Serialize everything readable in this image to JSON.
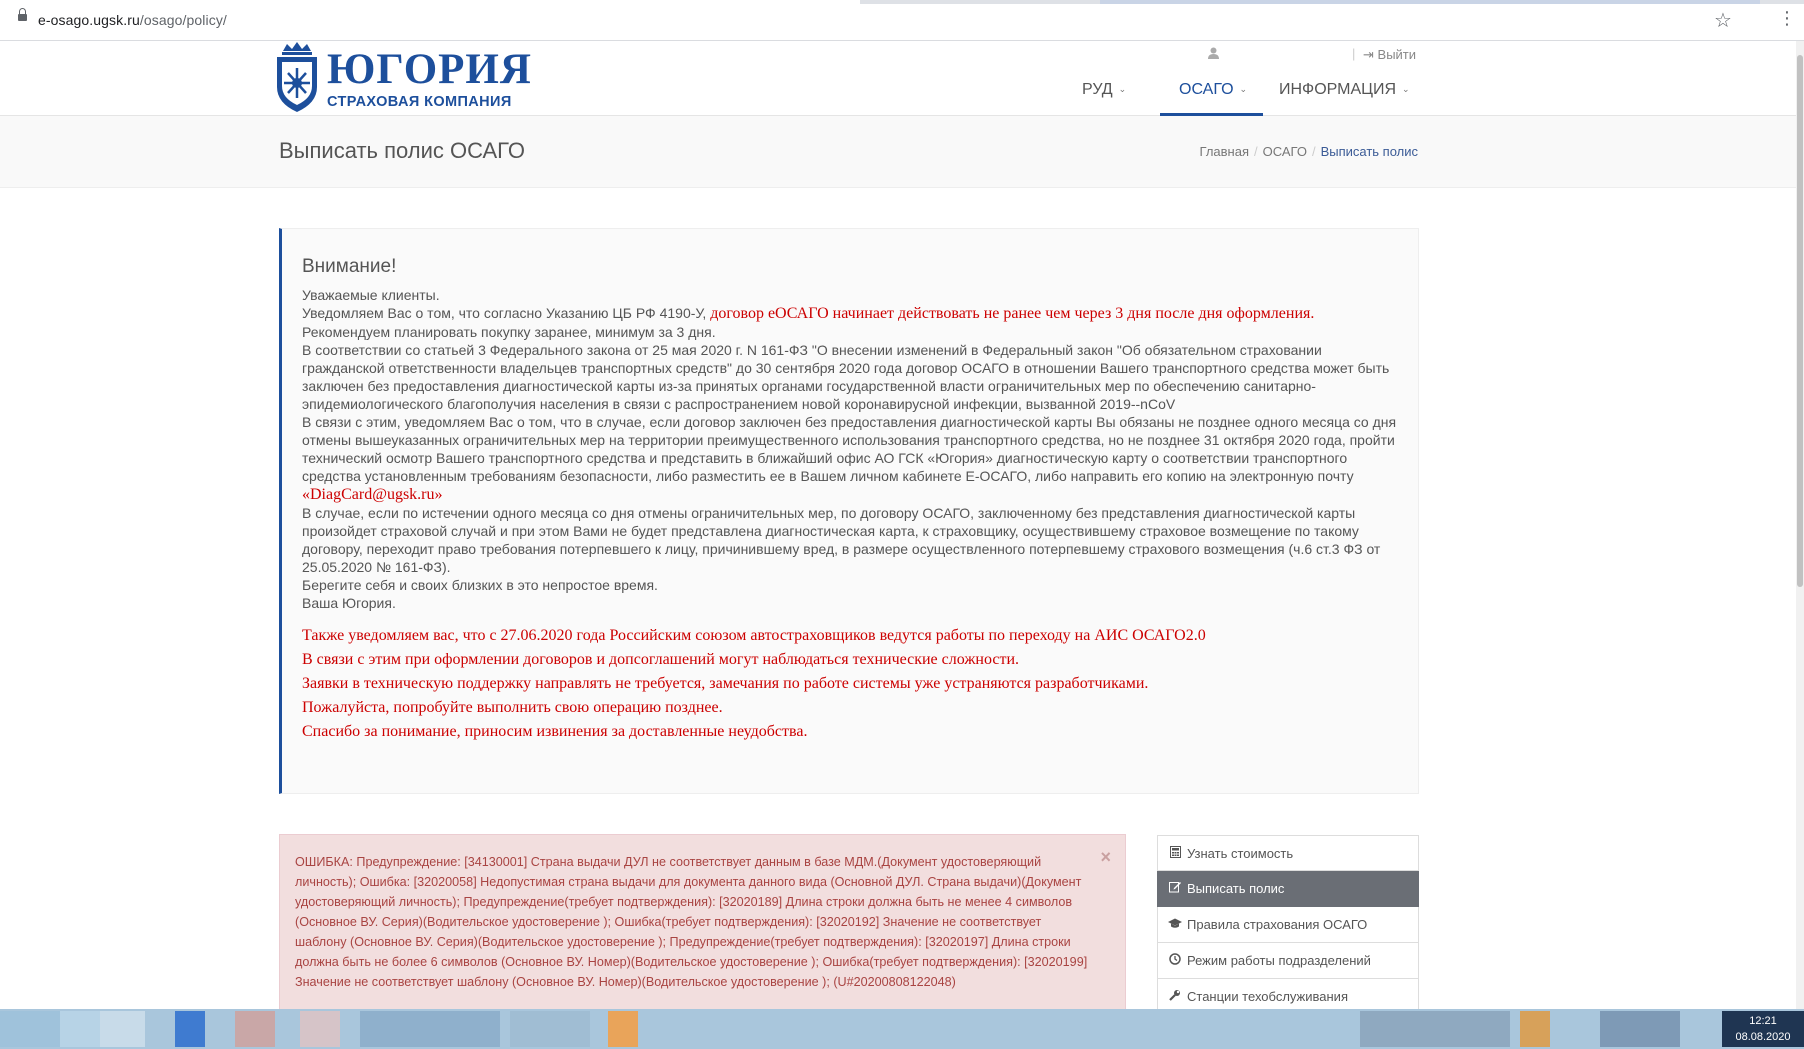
{
  "browser": {
    "url_host": "e-osago.ugsk.ru",
    "url_path": "/osago/policy/"
  },
  "header": {
    "brand": "ЮГОРИЯ",
    "brand_sub": "СТРАХОВАЯ КОМПАНИЯ",
    "logout_label": "Выйти",
    "nav": [
      {
        "label": "РУД"
      },
      {
        "label": "ОСАГО"
      },
      {
        "label": "ИНФОРМАЦИЯ"
      }
    ]
  },
  "page": {
    "title": "Выписать полис ОСАГО",
    "breadcrumbs": [
      "Главная",
      "ОСАГО",
      "Выписать полис"
    ]
  },
  "notice": {
    "heading": "Внимание!",
    "greeting": "Уважаемые клиенты.",
    "line1_prefix": "Уведомляем Вас о том, что согласно Указанию ЦБ РФ 4190-У, ",
    "line1_red": "договор еОСАГО начинает действовать не ранее чем через 3 дня после дня оформления.",
    "line2": "Рекомендуем планировать покупку заранее, минимум за 3 дня.",
    "para1": "В соответствии со статьей 3 Федерального закона от 25 мая 2020 г. N 161-ФЗ \"О внесении изменений в Федеральный закон \"Об обязательном страховании гражданской ответственности владельцев транспортных средств\" до 30 сентября 2020 года договор ОСАГО в отношении Вашего транспортного средства может быть заключен без предоставления диагностической карты из-за принятых органами государственной власти ограничительных мер по обеспечению санитарно-эпидемиологического благополучия населения в связи с распространением новой коронавирусной инфекции, вызванной 2019--nCoV",
    "para2": "В связи с этим, уведомляем Вас о том, что в случае, если договор заключен без предоставления диагностической карты Вы обязаны не позднее одного месяца со дня отмены вышеуказанных ограничительных мер на территории преимущественного использования транспортного средства, но не позднее 31 октября 2020 года, пройти технический осмотр Вашего транспортного средства и представить в ближайший офис АО ГСК «Югория» диагностическую карту о соответствии транспортного средства установленным требованиям безопасности, либо разместить ее в Вашем личном кабинете Е-ОСАГО, либо направить его копию на электронную почту ",
    "email": "«DiagCard@ugsk.ru»",
    "para3": "В случае, если по истечении одного месяца со дня отмены ограничительных мер, по договору ОСАГО, заключенному без представления диагностической карты произойдет страховой случай и при этом Вами не будет представлена диагностическая карта, к страховщику, осуществившему страховое возмещение по такому договору, переходит право требования потерпевшего к лицу, причинившему вред, в размере осуществленного потерпевшему страхового возмещения (ч.6 ст.3 ФЗ от 25.05.2020 № 161-ФЗ).",
    "para4": "Берегите себя и своих близких в это непростое время.",
    "signature": "Ваша Югория.",
    "red_lines": [
      "Также уведомляем вас, что с 27.06.2020 года Российским союзом автостраховщиков ведутся работы по переходу на АИС ОСАГО2.0",
      "В связи с этим при оформлении договоров и допсоглашений могут наблюдаться технические сложности.",
      "Заявки в техническую поддержку направлять не требуется, замечания по работе системы уже устраняются разработчиками.",
      "Пожалуйста, попробуйте выполнить свою операцию позднее.",
      "Спасибо за понимание, приносим извинения за доставленные неудобства."
    ]
  },
  "error": {
    "message": "ОШИБКА: Предупреждение: [34130001] Страна выдачи ДУЛ не соответствует данным в базе МДМ.(Документ удостоверяющий личность); Ошибка: [32020058] Недопустимая страна выдачи для документа данного вида (Основной ДУЛ. Страна выдачи)(Документ удостоверяющий личность); Предупреждение(требует подтверждения): [32020189] Длина строки должна быть не менее 4 символов (Основное ВУ. Серия)(Водительское удостоверение ); Ошибка(требует подтверждения): [32020192] Значение не соответствует шаблону (Основное ВУ. Серия)(Водительское удостоверение ); Предупреждение(требует подтверждения): [32020197] Длина строки должна быть не более 6 символов (Основное ВУ. Номер)(Водительское удостоверение ); Ошибка(требует подтверждения): [32020199] Значение не соответствует шаблону (Основное ВУ. Номер)(Водительское удостоверение ); (U#20200808122048)",
    "close_symbol": "×"
  },
  "sidemenu": [
    {
      "label": "Узнать стоимость",
      "icon": "calculator-icon"
    },
    {
      "label": "Выписать полис",
      "icon": "edit-icon"
    },
    {
      "label": "Правила страхования ОСАГО",
      "icon": "graduation-cap-icon"
    },
    {
      "label": "Режим работы подразделений",
      "icon": "clock-icon"
    },
    {
      "label": "Станции техобслуживания",
      "icon": "wrench-icon"
    }
  ],
  "taskbar": {
    "time": "12:21",
    "date": "08.08.2020"
  }
}
